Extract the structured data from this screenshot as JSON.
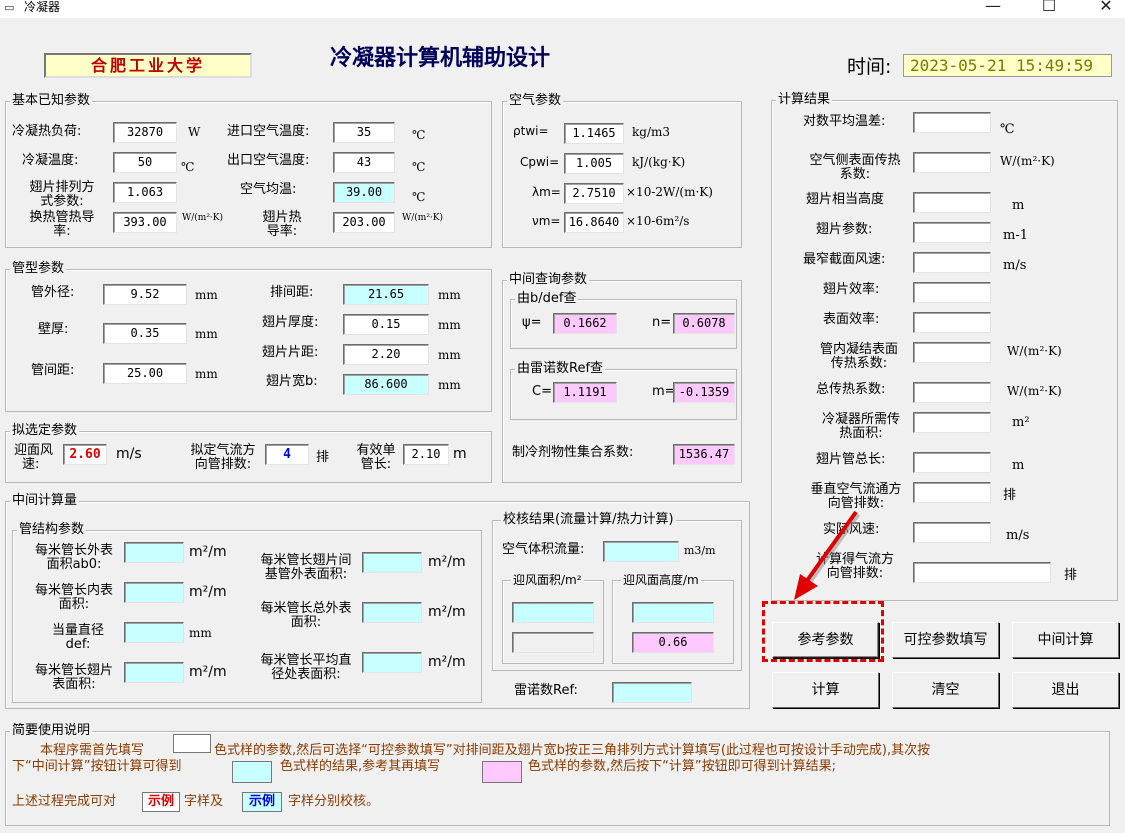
{
  "window": {
    "title": "冷凝器",
    "minimize": "—",
    "maximize": "☐",
    "close": "✕"
  },
  "header": {
    "school": "合肥工业大学",
    "title": "冷凝器计算机辅助设计",
    "time_label": "时间:",
    "time_value": "2023-05-21 15:49:59"
  },
  "basic": {
    "title": "基本已知参数",
    "heat_load_label": "冷凝热负荷:",
    "heat_load": "32870",
    "heat_load_unit": "W",
    "inlet_air_label": "进口空气温度:",
    "inlet_air": "35",
    "inlet_air_unit": "℃",
    "cond_temp_label": "冷凝温度:",
    "cond_temp": "50",
    "cond_temp_unit": "℃",
    "outlet_air_label": "出口空气温度:",
    "outlet_air": "43",
    "outlet_air_unit": "℃",
    "fin_arr_label_1": "翅片排列方",
    "fin_arr_label_2": "式参数:",
    "fin_arr": "1.063",
    "air_avg_label": "空气均温:",
    "air_avg": "39.00",
    "air_avg_unit": "℃",
    "tube_k_label_1": "换热管热导",
    "tube_k_label_2": "率:",
    "tube_k": "393.00",
    "tube_k_unit": "W/(m²·K)",
    "fin_k_label_1": "翅片热",
    "fin_k_label_2": "导率:",
    "fin_k": "203.00",
    "fin_k_unit": "W/(m²·K)"
  },
  "air": {
    "title": "空气参数",
    "rho_label": "ρtwi=",
    "rho": "1.1465",
    "rho_unit": "kg/m3",
    "cp_label": "Cpwi=",
    "cp": "1.005",
    "cp_unit": "kJ/(kg·K)",
    "lambda_label": "λm=",
    "lambda": "2.7510",
    "lambda_unit": "×10-2W/(m·K)",
    "nu_label": "νm=",
    "nu": "16.8640",
    "nu_unit": "×10-6m²/s"
  },
  "tube": {
    "title": "管型参数",
    "od_label": "管外径:",
    "od": "9.52",
    "od_unit": "mm",
    "row_pitch_label": "排间距:",
    "row_pitch": "21.65",
    "row_pitch_unit": "mm",
    "fin_thick_label": "翅片厚度:",
    "fin_thick": "0.15",
    "fin_thick_unit": "mm",
    "wall_label": "壁厚:",
    "wall": "0.35",
    "wall_unit": "mm",
    "fin_pitch_label": "翅片片距:",
    "fin_pitch": "2.20",
    "fin_pitch_unit": "mm",
    "tube_pitch_label": "管间距:",
    "tube_pitch": "25.00",
    "tube_pitch_unit": "mm",
    "fin_width_label": "翅片宽b:",
    "fin_width": "86.600",
    "fin_width_unit": "mm"
  },
  "query": {
    "title": "中间查询参数",
    "def_title": "由b/def查",
    "psi_label": "ψ=",
    "psi": "0.1662",
    "n_label": "n=",
    "n": "0.6078",
    "re_title": "由雷诺数Ref查",
    "c_label": "C=",
    "c": "1.1191",
    "m_label": "m=",
    "m": "-0.1359",
    "refrig_label": "制冷剂物性集合系数:",
    "refrig": "1536.47"
  },
  "chosen": {
    "title": "拟选定参数",
    "face_vel_label_1": "迎面风",
    "face_vel_label_2": "速:",
    "face_vel": "2.60",
    "face_vel_unit": "m/s",
    "rows_label_1": "拟定气流方",
    "rows_label_2": "向管排数:",
    "rows": "4",
    "rows_unit": "排",
    "eff_len_label_1": "有效单",
    "eff_len_label_2": "管长:",
    "eff_len": "2.10",
    "eff_len_unit": "m"
  },
  "mid": {
    "title": "中间计算量",
    "struct_title": "管结构参数",
    "outer_area_label_1": "每米管长外表",
    "outer_area_label_2": "面积ab0:",
    "outer_area_unit": "m²/m",
    "fin_base_label_1": "每米管长翅片间",
    "fin_base_label_2": "基管外表面积:",
    "fin_base_unit": "m²/m",
    "inner_area_label_1": "每米管长内表",
    "inner_area_label_2": "面积:",
    "inner_area_unit": "m²/m",
    "total_outer_label_1": "每米管长总外表",
    "total_outer_label_2": "面积:",
    "total_outer_unit": "m²/m",
    "equiv_dia_label_1": "当量直径",
    "equiv_dia_label_2": "def:",
    "equiv_dia_unit": "mm",
    "fin_surface_label_1": "每米管长翅片",
    "fin_surface_label_2": "表面积:",
    "fin_surface_unit": "m²/m",
    "avg_dia_label_1": "每米管长平均直",
    "avg_dia_label_2": "径处表面积:",
    "avg_dia_unit": "m²/m",
    "check_title": "校核结果(流量计算/热力计算)",
    "air_flow_label": "空气体积流量:",
    "air_flow_unit": "m3/m",
    "face_area_title": "迎风面积/m²",
    "face_height_title": "迎风面高度/m",
    "face_height2": "0.66",
    "reynolds_label": "雷诺数Ref:"
  },
  "results": {
    "title": "计算结果",
    "lmtd_label": "对数平均温差:",
    "lmtd_unit": "℃",
    "air_htc_label_1": "空气侧表面传热",
    "air_htc_label_2": "系数:",
    "air_htc_unit": "W/(m²·K)",
    "fin_height_label": "翅片相当高度",
    "fin_height_unit": "m",
    "fin_param_label": "翅片参数:",
    "fin_param_unit": "m-1",
    "max_vel_label": "最窄截面风速:",
    "max_vel_unit": "m/s",
    "fin_eff_label": "翅片效率:",
    "surf_eff_label": "表面效率:",
    "tube_htc_label_1": "管内凝结表面",
    "tube_htc_label_2": "传热系数:",
    "tube_htc_unit": "W/(m²·K)",
    "total_k_label": "总传热系数:",
    "total_k_unit": "W/(m²·K)",
    "area_label_1": "冷凝器所需传",
    "area_label_2": "热面积:",
    "area_unit": "m²",
    "fin_tube_len_label": "翅片管总长:",
    "fin_tube_len_unit": "m",
    "vert_rows_label_1": "垂直空气流通方",
    "vert_rows_label_2": "向管排数:",
    "vert_rows_unit": "排",
    "actual_vel_label": "实际风速:",
    "actual_vel_unit": "m/s",
    "calc_rows_label_1": "计算得气流方",
    "calc_rows_label_2": "向管排数:",
    "calc_rows_unit": "排"
  },
  "buttons": {
    "reference": "参考参数",
    "controllable": "可控参数填写",
    "intermediate": "中间计算",
    "calculate": "计算",
    "clear": "清空",
    "exit": "退出"
  },
  "usage": {
    "title": "简要使用说明",
    "line1a": "本程序需首先填写",
    "line1b": "色式样的参数,然后可选择“可控参数填写”对排间距及翅片宽b按正三角排列方式计算填写(此过程也可按设计手动完成),其次按",
    "line2a": "下“中间计算”按钮计算可得到",
    "line2b": "色式样的结果,参考其再填写",
    "line2c": "色式样的参数,然后按下“计算”按钮即可得到计算结果;",
    "line3a": "上述过程完成可对",
    "sample_red": "示例",
    "line3b": "字样及",
    "sample_blue": "示例",
    "line3c": "字样分别校核。"
  },
  "colors": {
    "cyan": "#c8ffff",
    "pink": "#ffc8ff",
    "yellow": "#ffffc8",
    "highlight": "#e00000"
  }
}
